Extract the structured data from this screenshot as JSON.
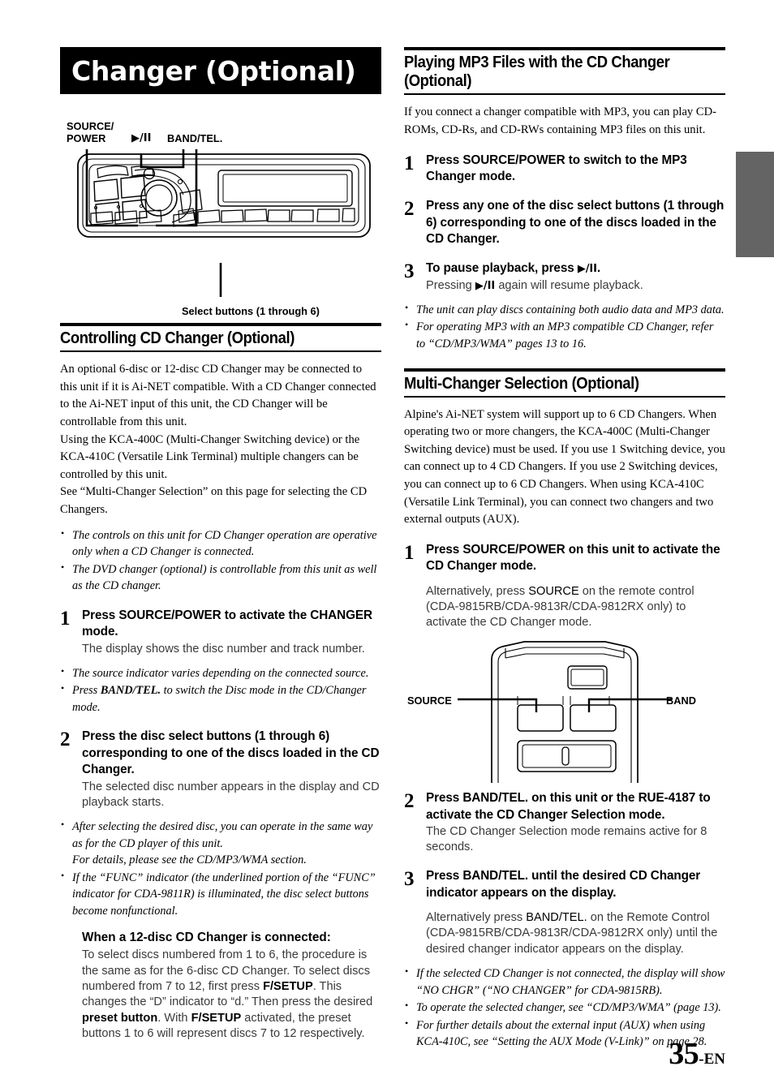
{
  "page": {
    "banner_title": "Changer (Optional)",
    "folio_number": "35",
    "folio_suffix": "-EN"
  },
  "unit_diagram": {
    "labels": {
      "source_power_line1": "SOURCE/",
      "source_power_line2": "POWER",
      "play_pause": "▶/II",
      "band_tel": "BAND/TEL.",
      "select_buttons": "Select buttons (1 through 6)"
    }
  },
  "remote_diagram": {
    "labels": {
      "source": "SOURCE",
      "band": "BAND"
    }
  },
  "left_column": {
    "section": {
      "heading": "Controlling CD Changer (Optional)",
      "paragraphs": [
        "An optional 6-disc or 12-disc CD Changer may be connected to this unit if it is Ai-NET compatible. With a CD Changer connected to the Ai-NET input of this unit, the CD Changer will be controllable from this unit.",
        "Using the KCA-400C (Multi-Changer Switching device) or the KCA-410C (Versatile Link Terminal) multiple changers can be controlled by this unit.",
        "See “Multi-Changer Selection” on this page for selecting the CD Changers."
      ],
      "notes_1": [
        "The controls on this unit for CD Changer operation are operative only when a CD Changer is connected.",
        "The DVD changer (optional) is controllable from this unit as well as the CD changer."
      ],
      "step1": {
        "number": "1",
        "title_a": "Press ",
        "title_b": "SOURCE/POWER",
        "title_c": " to activate the CHANGER mode.",
        "desc": "The display shows the disc number and track number."
      },
      "notes_2": [
        "The source indicator varies depending on the connected source.",
        "Press BAND/TEL. to switch the Disc mode in the CD/Changer mode."
      ],
      "step2": {
        "number": "2",
        "title_a": "Press the disc ",
        "title_b": "select buttons (1 through 6)",
        "title_c": " corresponding to one of the discs loaded in the CD Changer.",
        "desc": "The selected disc number appears in the display and CD playback starts."
      },
      "notes_3": [
        "After selecting the desired disc, you can operate in the same way as for the CD player of this unit.",
        "If the “FUNC” indicator (the underlined portion of the “FUNC” indicator for CDA-9811R) is illuminated, the disc select buttons become nonfunctional."
      ],
      "notes_3_sub": "For details, please see the CD/MP3/WMA section.",
      "subblock": {
        "title": "When a 12-disc CD Changer is connected:",
        "text_part1": "To select discs numbered from 1 to 6, the procedure is the same as for the 6-disc CD Changer. To select discs numbered from 7 to 12, first press ",
        "text_b1": "F/SETUP",
        "text_part2": ". This changes the “D” indicator to “d.” Then press the desired ",
        "text_b2": "preset button",
        "text_part3": ". With ",
        "text_b3": "F/SETUP",
        "text_part4": " activated, the preset buttons 1 to 6 will represent discs 7 to 12 respectively."
      }
    }
  },
  "right_column": {
    "mp3_section": {
      "heading_line1": "Playing MP3 Files with the CD Changer",
      "heading_line2": "(Optional)",
      "intro": "If you connect a changer compatible with MP3, you can play CD-ROMs, CD-Rs, and CD-RWs containing MP3 files on this unit.",
      "step1": {
        "number": "1",
        "title_a": "Press ",
        "title_b": "SOURCE/POWER",
        "title_c": " to switch to the MP3 Changer mode."
      },
      "step2": {
        "number": "2",
        "title_a": "Press any one of the disc ",
        "title_b": "select buttons (1 through 6)",
        "title_c": " corresponding to one of the discs loaded in the CD Changer."
      },
      "step3": {
        "number": "3",
        "title_a": "To pause playback, press ",
        "title_b": "▶/II",
        "title_c": ".",
        "desc_a": "Pressing ",
        "desc_b": "▶/II",
        "desc_c": " again will resume playback."
      },
      "notes": [
        "The unit can play discs containing both audio data and MP3 data.",
        "For operating MP3 with an MP3 compatible CD Changer, refer to “CD/MP3/WMA” pages 13 to 16."
      ]
    },
    "multi_section": {
      "heading": "Multi-Changer Selection (Optional)",
      "intro": "Alpine's Ai-NET system will support up to 6 CD Changers. When operating two or more changers, the KCA-400C (Multi-Changer Switching device) must be used. If you use 1 Switching device, you can connect up to 4 CD Changers. If you use 2 Switching devices, you can connect up to 6 CD Changers. When using KCA-410C (Versatile Link Terminal), you can connect two changers and two external outputs (AUX).",
      "step1": {
        "number": "1",
        "title_a": "Press ",
        "title_b": "SOURCE/POWER",
        "title_c": " on this unit to activate the CD Changer mode.",
        "desc_a": "Alternatively, press ",
        "desc_b": "SOURCE",
        "desc_c": " on the remote control (CDA-9815RB/CDA-9813R/CDA-9812RX only) to activate the CD Changer mode."
      },
      "step2": {
        "number": "2",
        "title_a": "Press ",
        "title_b": "BAND/TEL.",
        "title_c": " on this unit or the RUE-4187 to activate the CD Changer Selection mode.",
        "desc": "The CD Changer Selection mode remains active for 8 seconds."
      },
      "step3": {
        "number": "3",
        "title_a": "Press ",
        "title_b": "BAND/TEL.",
        "title_c": " until the desired CD Changer indicator appears on the display.",
        "desc_a": "Alternatively press ",
        "desc_b": "BAND/TEL.",
        "desc_c": " on the Remote Control (CDA-9815RB/CDA-9813R/CDA-9812RX only) until the desired changer indicator appears on the display."
      },
      "notes": [
        "If the selected CD Changer is not connected, the display will show “NO CHGR” (“NO CHANGER” for CDA-9815RB).",
        "To operate the selected changer, see “CD/MP3/WMA” (page 13).",
        "For further details about the external input (AUX) when using KCA-410C, see “Setting the AUX Mode (V-Link)” on page 28."
      ]
    }
  }
}
